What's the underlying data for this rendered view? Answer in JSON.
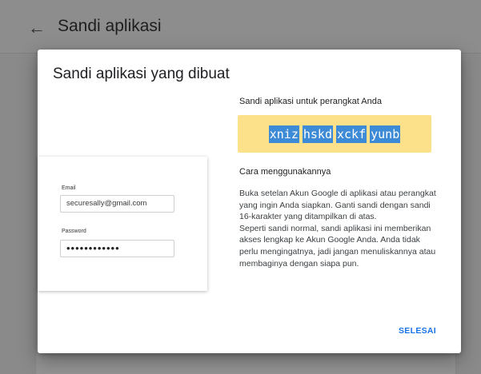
{
  "page": {
    "back_icon": "arrow-left-icon",
    "title": "Sandi aplikasi"
  },
  "dialog": {
    "title": "Sandi aplikasi yang dibuat",
    "illustration": {
      "email_label": "Email",
      "email_value": "securesally@gmail.com",
      "password_label": "Password",
      "password_value": "••••••••••••"
    },
    "password_heading": "Sandi aplikasi untuk perangkat Anda",
    "password_groups": [
      "xniz",
      "hskd",
      "xckf",
      "yunb"
    ],
    "password_box_color": "#fde18a",
    "password_highlight_color": "#3d8ad6",
    "how_to_heading": "Cara menggunakannya",
    "instructions_1": "Buka setelan Akun Google di aplikasi atau perangkat yang ingin Anda siapkan. Ganti sandi dengan sandi 16-karakter yang ditampilkan di atas.",
    "instructions_2": "Seperti sandi normal, sandi aplikasi ini memberikan akses lengkap ke Akun Google Anda. Anda tidak perlu mengingatnya, jadi jangan menuliskannya atau membaginya dengan siapa pun.",
    "done_label": "SELESAI",
    "accent_color": "#1a73e8"
  }
}
